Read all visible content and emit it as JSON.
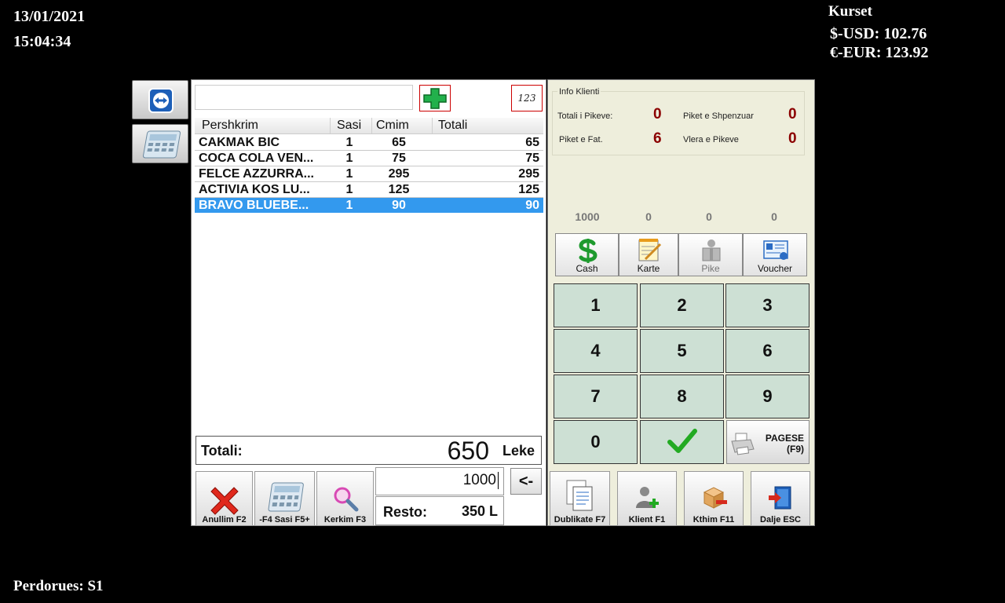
{
  "header": {
    "date": "13/01/2021",
    "time": "15:04:34",
    "rates_title": "Kurset",
    "usd": "$-USD: 102.76",
    "eur": "€-EUR: 123.92",
    "user": "Perdorues: S1"
  },
  "search": {
    "value": "",
    "placeholder": ""
  },
  "numpad_toggle_label": "123",
  "grid": {
    "columns": [
      "Pershkrim",
      "Sasi",
      "Cmim",
      "Totali"
    ],
    "rows": [
      {
        "desc": "CAKMAK BIC",
        "qty": "1",
        "price": "65",
        "total": "65"
      },
      {
        "desc": "COCA COLA VEN...",
        "qty": "1",
        "price": "75",
        "total": "75"
      },
      {
        "desc": "FELCE AZZURRA...",
        "qty": "1",
        "price": "295",
        "total": "295"
      },
      {
        "desc": "ACTIVIA  KOS LU...",
        "qty": "1",
        "price": "125",
        "total": "125"
      },
      {
        "desc": "BRAVO BLUEBE...",
        "qty": "1",
        "price": "90",
        "total": "90"
      }
    ],
    "selected_row": 4
  },
  "totals": {
    "label": "Totali:",
    "value": "650",
    "currency": "Leke"
  },
  "payment": {
    "input_value": "1000",
    "backspace_label": "<-",
    "change_label": "Resto:",
    "change_value": "350 L"
  },
  "tools": [
    {
      "label": "Anullim F2",
      "icon": "cancel-x-icon"
    },
    {
      "label": "-F4 Sasi F5+",
      "icon": "calculator-icon"
    },
    {
      "label": "Kerkim F3",
      "icon": "magnifier-icon"
    }
  ],
  "client_info": {
    "title": "Info Klienti",
    "total_points_label": "Totali i Pikeve:",
    "total_points": "0",
    "spent_points_label": "Piket e Shpenzuar",
    "spent_points": "0",
    "invoice_points_label": "Piket e Fat.",
    "invoice_points": "6",
    "points_value_label": "Vlera e Pikeve",
    "points_value": "0"
  },
  "tender_amounts": [
    "1000",
    "0",
    "0",
    "0"
  ],
  "tenders": [
    {
      "label": "Cash",
      "icon": "cash-dollar-icon",
      "enabled": true
    },
    {
      "label": "Karte",
      "icon": "card-notepad-icon",
      "enabled": true
    },
    {
      "label": "Pike",
      "icon": "points-gift-icon",
      "enabled": false
    },
    {
      "label": "Voucher",
      "icon": "voucher-icon",
      "enabled": true
    }
  ],
  "keypad": [
    "1",
    "2",
    "3",
    "4",
    "5",
    "6",
    "7",
    "8",
    "9",
    "0"
  ],
  "pay_button": {
    "line1": "PAGESE",
    "line2": "(F9)"
  },
  "bottom_buttons": [
    {
      "label": "Dublikate F7",
      "icon": "duplicate-document-icon"
    },
    {
      "label": "Klient F1",
      "icon": "add-client-icon"
    },
    {
      "label": "Kthim F11",
      "icon": "return-box-icon"
    },
    {
      "label": "Dalje ESC",
      "icon": "exit-door-icon"
    }
  ],
  "colors": {
    "selection": "#3399ee",
    "keypad": "#cde0d4",
    "panel": "#eeeedc",
    "points_red": "#8b0000",
    "confirm_green": "#22aa22"
  }
}
